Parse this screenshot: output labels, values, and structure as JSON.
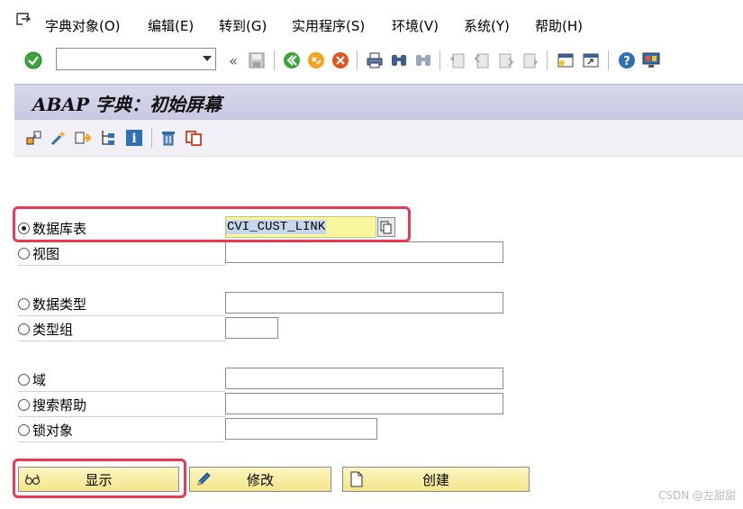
{
  "menubar": {
    "items": [
      "字典对象(O)",
      "编辑(E)",
      "转到(G)",
      "实用程序(S)",
      "环境(V)",
      "系统(Y)",
      "帮助(H)"
    ]
  },
  "toolbar": {
    "command_value": "",
    "icons": [
      "enter-check-icon",
      "back-icon",
      "save-icon",
      "green-back-icon",
      "exit-icon",
      "cancel-icon",
      "print-icon",
      "find-icon",
      "find-next-icon",
      "first-page-icon",
      "previous-page-icon",
      "next-page-icon",
      "last-page-icon",
      "create-session-icon",
      "shortcut-icon",
      "help-icon",
      "customize-layout-icon"
    ]
  },
  "title": "ABAP 字典：初始屏幕",
  "app_toolbar": {
    "icons": [
      "other-object-icon",
      "activate-icon",
      "where-used-icon",
      "object-list-icon",
      "info-icon",
      "delete-icon",
      "copy-icon"
    ]
  },
  "form": {
    "db_table": {
      "label": "数据库表",
      "value": "CVI_CUST_LINK",
      "selected": true
    },
    "view": {
      "label": "视图",
      "value": ""
    },
    "data_type": {
      "label": "数据类型",
      "value": ""
    },
    "type_group": {
      "label": "类型组",
      "value": ""
    },
    "domain": {
      "label": "域",
      "value": ""
    },
    "search_help": {
      "label": "搜索帮助",
      "value": ""
    },
    "lock_object": {
      "label": "锁对象",
      "value": ""
    }
  },
  "buttons": {
    "display": "显示",
    "change": "修改",
    "create": "创建"
  },
  "watermark": "CSDN @左甜甜",
  "colors": {
    "title_bg": "#cfcfe8",
    "button_bg": "#f6ea9c",
    "highlight_box": "#e83a54",
    "input_focus_bg": "#f9f6a0"
  }
}
